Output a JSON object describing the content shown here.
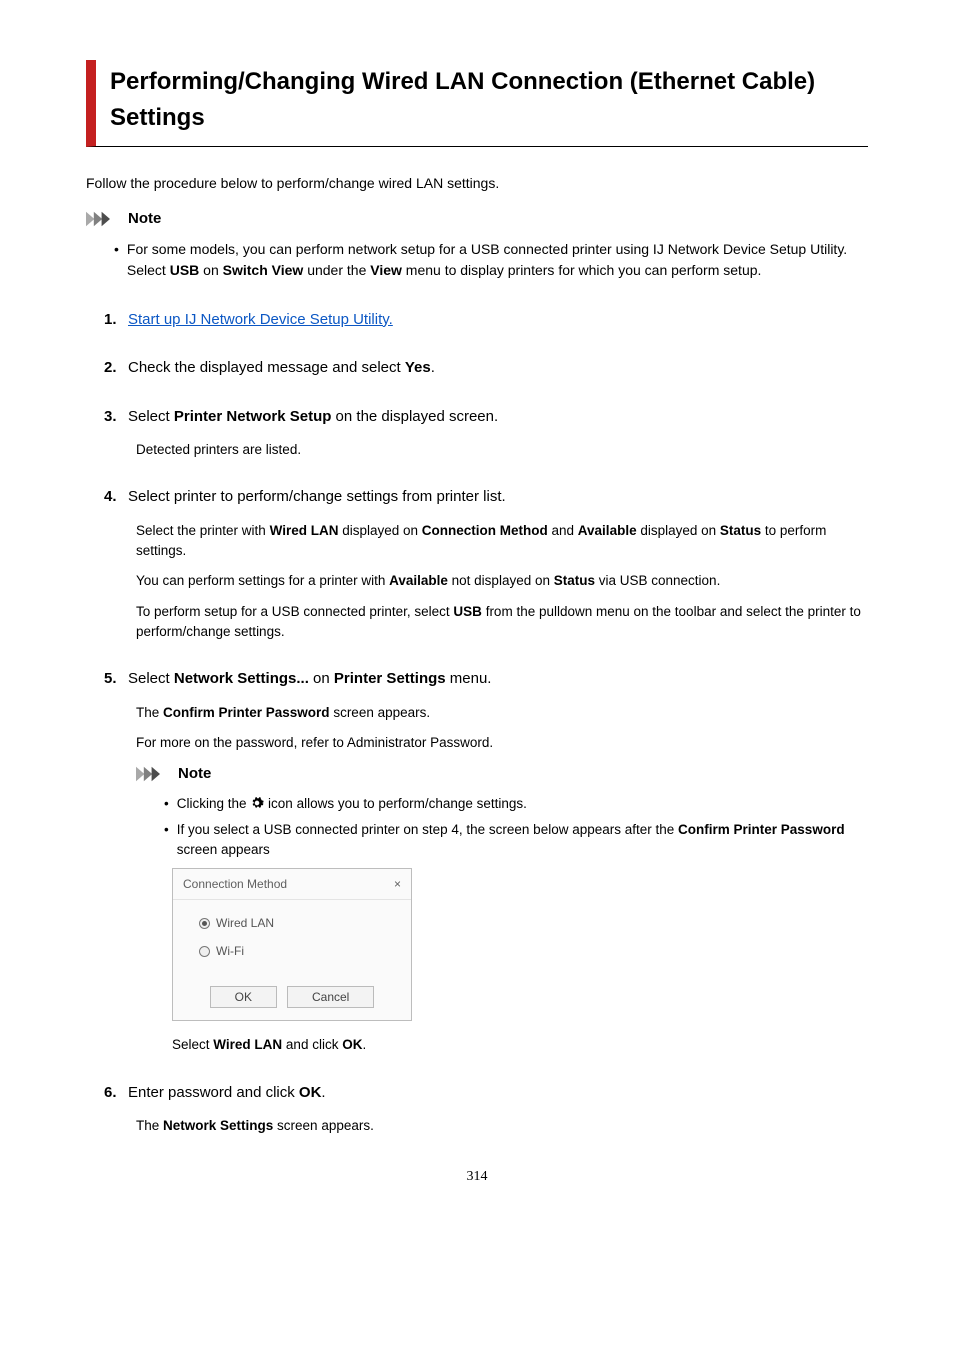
{
  "title": "Performing/Changing Wired LAN Connection (Ethernet Cable) Settings",
  "intro": "Follow the procedure below to perform/change wired LAN settings.",
  "note_label": "Note",
  "top_note": {
    "pre": "For some models, you can perform network setup for a USB connected printer using IJ Network Device Setup Utility. Select ",
    "b1": "USB",
    "mid1": " on ",
    "b2": "Switch View",
    "mid2": " under the ",
    "b3": "View",
    "post": " menu to display printers for which you can perform setup."
  },
  "steps": {
    "s1": {
      "link": "Start up IJ Network Device Setup Utility."
    },
    "s2": {
      "pre": "Check the displayed message and select ",
      "b1": "Yes",
      "post": "."
    },
    "s3": {
      "head_pre": "Select ",
      "head_b": "Printer Network Setup",
      "head_post": " on the displayed screen.",
      "body": "Detected printers are listed."
    },
    "s4": {
      "head": "Select printer to perform/change settings from printer list.",
      "p1": {
        "pre": "Select the printer with ",
        "b1": "Wired LAN",
        "mid1": " displayed on ",
        "b2": "Connection Method",
        "mid2": " and ",
        "b3": "Available",
        "mid3": " displayed on ",
        "b4": "Status",
        "post": " to perform settings."
      },
      "p2": {
        "pre": "You can perform settings for a printer with ",
        "b1": "Available",
        "mid1": " not displayed on ",
        "b2": "Status",
        "post": " via USB connection."
      },
      "p3": {
        "pre": "To perform setup for a USB connected printer, select ",
        "b1": "USB",
        "post": " from the pulldown menu on the toolbar and select the printer to perform/change settings."
      }
    },
    "s5": {
      "head_pre": "Select ",
      "head_b1": "Network Settings...",
      "head_mid": " on ",
      "head_b2": "Printer Settings",
      "head_post": " menu.",
      "p1": {
        "pre": "The ",
        "b": "Confirm Printer Password",
        "post": " screen appears."
      },
      "p2": "For more on the password, refer to Administrator Password.",
      "note_b1_pre": "Clicking the ",
      "note_b1_post": " icon allows you to perform/change settings.",
      "note_b2": {
        "pre": "If you select a USB connected printer on step 4, the screen below appears after the ",
        "b": "Confirm Printer Password",
        "post": " screen appears"
      },
      "dialog": {
        "title": "Connection Method",
        "opt1": "Wired LAN",
        "opt2": "Wi-Fi",
        "ok": "OK",
        "cancel": "Cancel"
      },
      "after_dialog": {
        "pre": "Select ",
        "b1": "Wired LAN",
        "mid": " and click ",
        "b2": "OK",
        "post": "."
      }
    },
    "s6": {
      "head_pre": "Enter password and click ",
      "head_b": "OK",
      "head_post": ".",
      "p1": {
        "pre": "The ",
        "b": "Network Settings",
        "post": " screen appears."
      }
    }
  },
  "page_number": "314"
}
